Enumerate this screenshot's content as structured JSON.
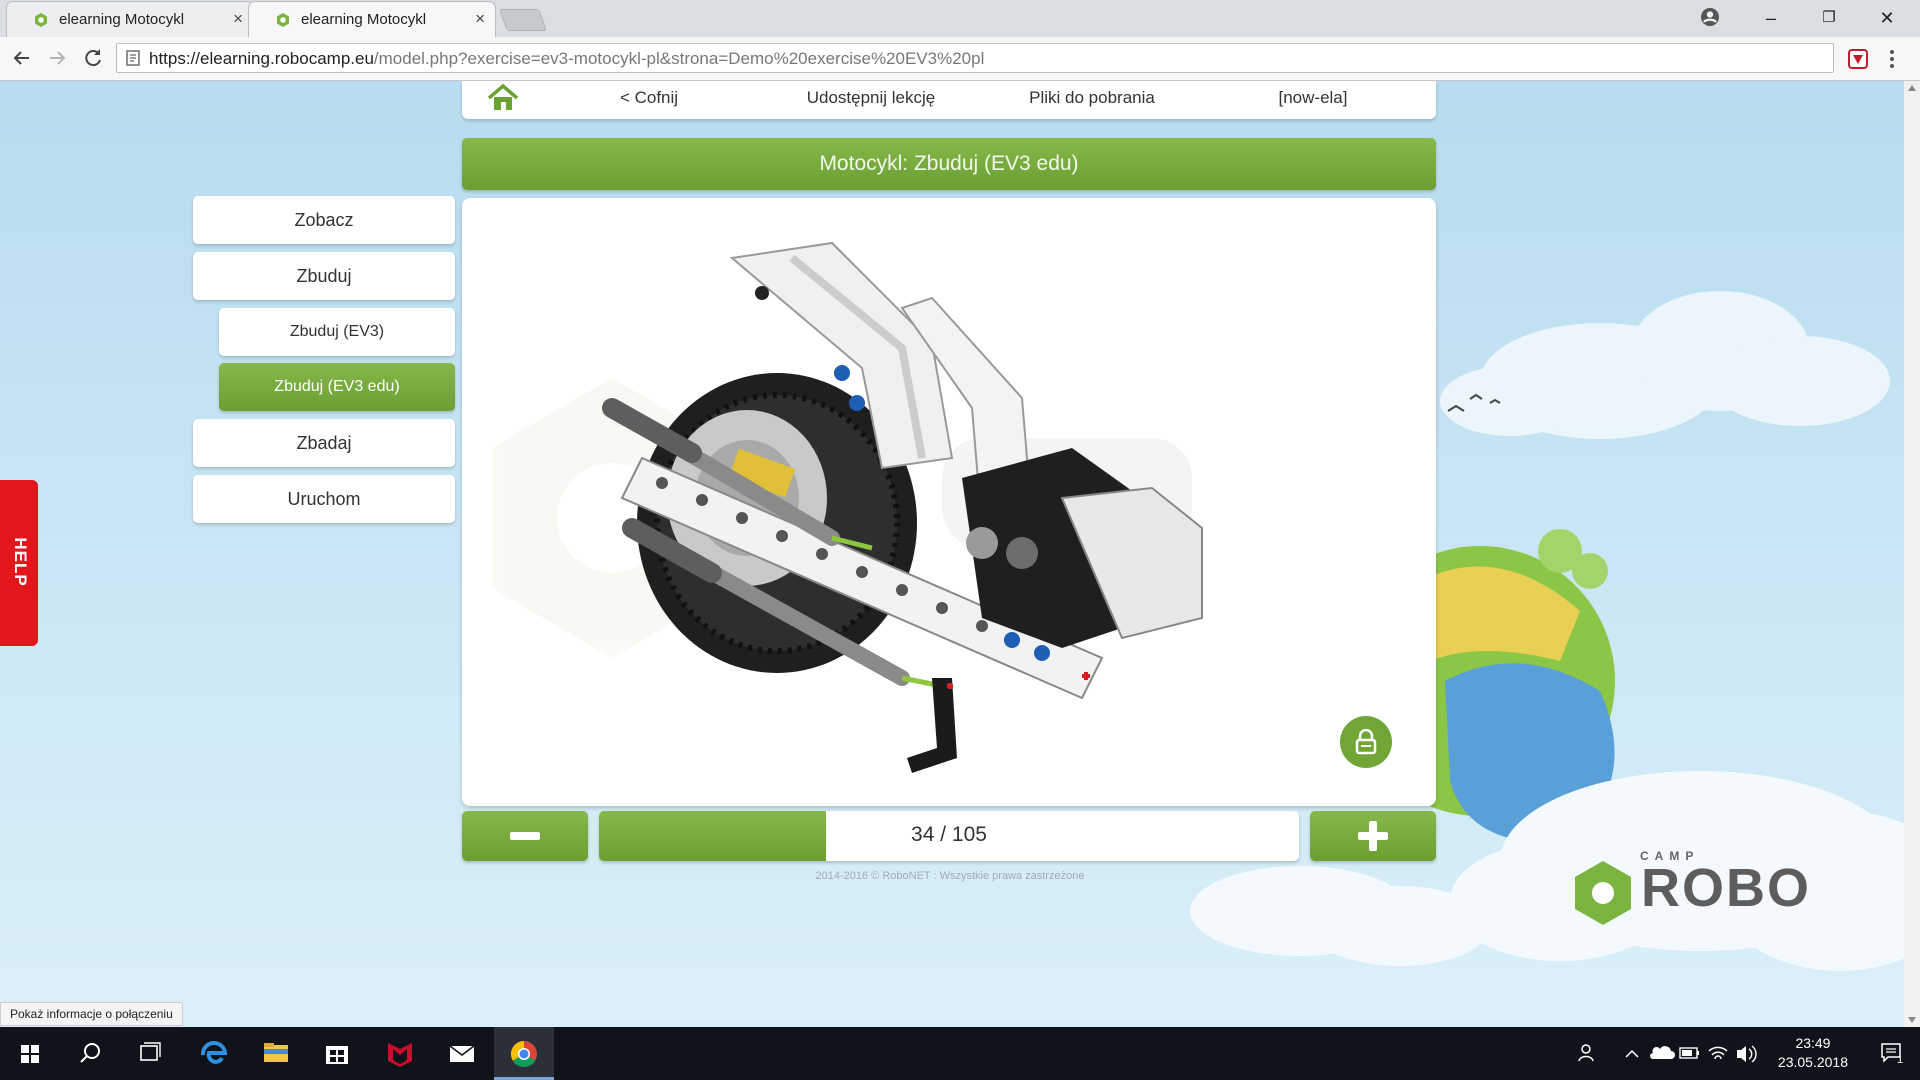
{
  "browser": {
    "tabs": [
      {
        "title": "elearning Motocykl",
        "close": "×",
        "active": false
      },
      {
        "title": "elearning Motocykl",
        "close": "×",
        "active": true
      }
    ],
    "url_host": "https://elearning.robocamp.eu",
    "url_path": "/model.php?exercise=ev3-motocykl-pl&strona=Demo%20exercise%20EV3%20pl",
    "status_tooltip": "Pokaż informacje o połączeniu",
    "window_controls": {
      "minimize": "–",
      "restore": "❐",
      "close": "✕"
    }
  },
  "nav": {
    "back": "< Cofnij",
    "share": "Udostępnij lekcję",
    "downloads": "Pliki do pobrania",
    "user": "[now-ela]"
  },
  "page_title": "Motocykl: Zbuduj (EV3 edu)",
  "sidebar": {
    "items": [
      {
        "label": "Zobacz",
        "level": 0,
        "active": false
      },
      {
        "label": "Zbuduj",
        "level": 0,
        "active": false
      },
      {
        "label": "Zbuduj (EV3)",
        "level": 1,
        "active": false
      },
      {
        "label": "Zbuduj (EV3 edu)",
        "level": 1,
        "active": true
      },
      {
        "label": "Zbadaj",
        "level": 0,
        "active": false
      },
      {
        "label": "Uruchom",
        "level": 0,
        "active": false
      }
    ]
  },
  "stepper": {
    "current": 34,
    "total": 105,
    "label": "34 / 105"
  },
  "help_label": "HELP",
  "copyright": "2014-2016 © RoboNET : Wszystkie prawa zastrzeżone",
  "logo": {
    "top": "CAMP",
    "main": "ROBO"
  },
  "taskbar": {
    "time": "23:49",
    "date": "23.05.2018",
    "notification_count": "1"
  },
  "colors": {
    "accent_green": "#78ac3c",
    "help_red": "#e3161b",
    "sky": "#c6e4f3"
  }
}
